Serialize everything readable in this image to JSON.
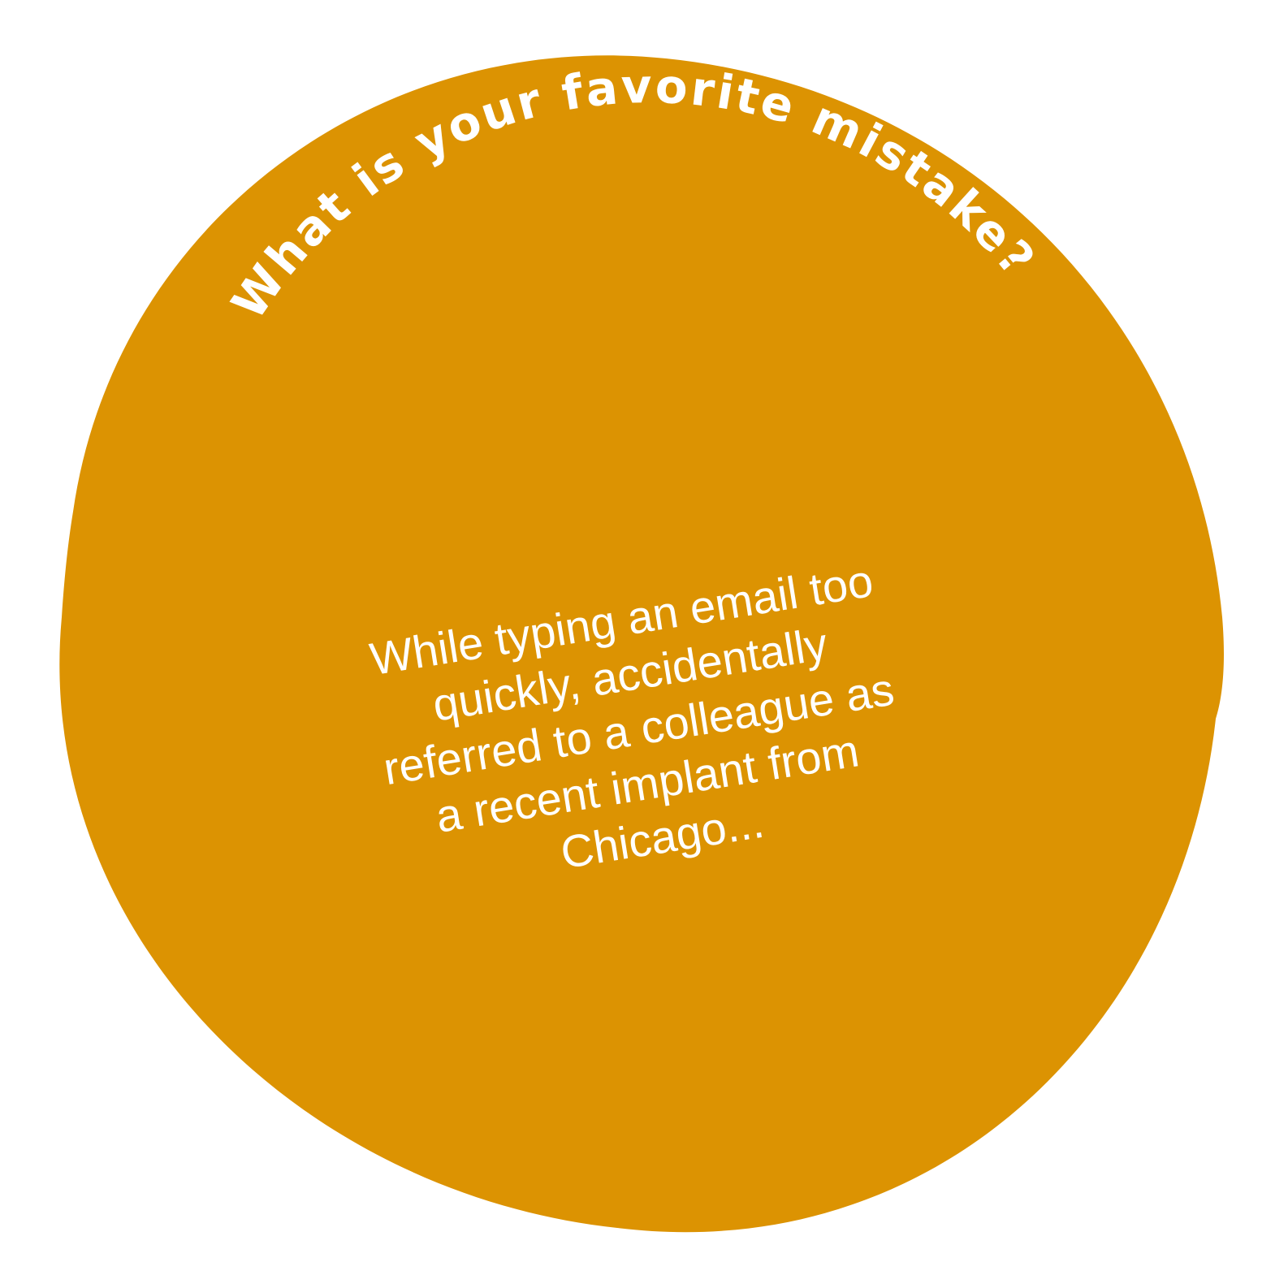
{
  "colors": {
    "background": "#ffffff",
    "blob": "#dc9302",
    "text": "#ffffff"
  },
  "card": {
    "question": "What is your favorite mistake?",
    "answer_lines": [
      "While typing an email too",
      "quickly, accidentally",
      "referred to a colleague as",
      "a recent implant from",
      "Chicago..."
    ]
  }
}
